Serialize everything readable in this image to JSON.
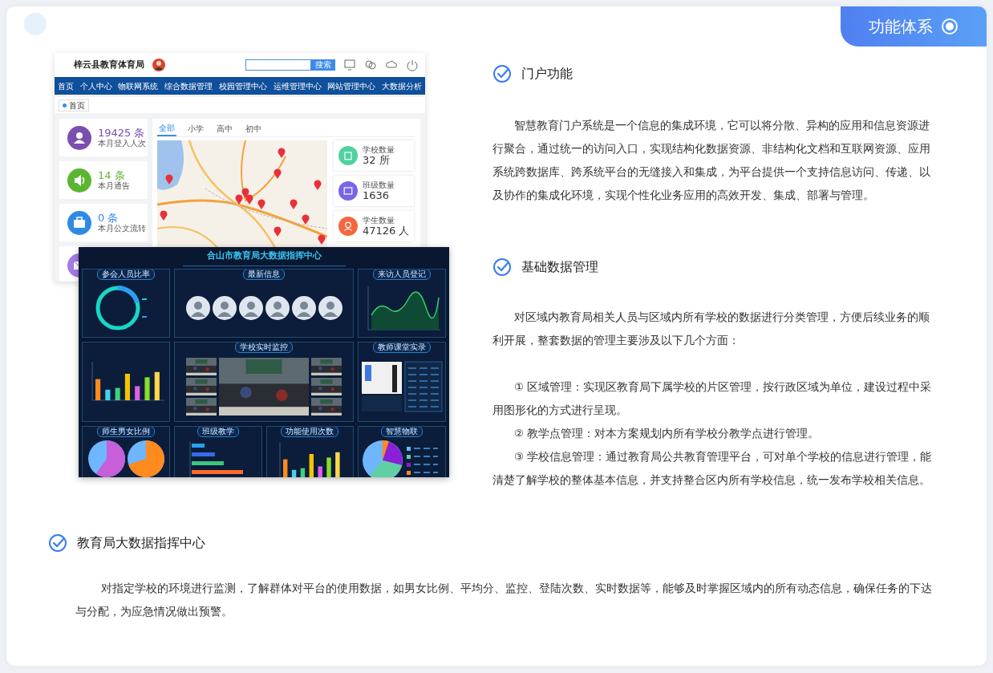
{
  "badge": {
    "label": "功能体系"
  },
  "portal": {
    "title": "梓云县教育体育局",
    "search_button": "搜索",
    "nav": [
      "首页",
      "个人中心",
      "物联网系统",
      "综合数据管理",
      "校园管理中心",
      "运维管理中心",
      "网站管理中心",
      "大数据分析"
    ],
    "breadcrumb": "首页",
    "stats": [
      {
        "value": "19425",
        "unit": "条",
        "label": "本月登入人次",
        "color": "#7b4fb0"
      },
      {
        "value": "14",
        "unit": "条",
        "label": "本月通告",
        "color": "#5cb531"
      },
      {
        "value": "0",
        "unit": "条",
        "label": "本月公文流转",
        "color": "#2f8ae5"
      },
      {
        "color": "#a47be8"
      }
    ],
    "tabs": [
      {
        "label": "全部",
        "selected": true
      },
      {
        "label": "小学",
        "selected": false
      },
      {
        "label": "高中",
        "selected": false
      },
      {
        "label": "初中",
        "selected": false
      }
    ],
    "counts": [
      {
        "label": "学校数量",
        "value": "32",
        "unit": "所",
        "color": "#4fd1a0"
      },
      {
        "label": "班级数量",
        "value": "1636",
        "color": "#7a63e8"
      },
      {
        "label": "学生数量",
        "value": "47126",
        "unit": "人",
        "color": "#f4663f"
      }
    ]
  },
  "dashboard": {
    "title": "合山市教育局大数据指挥中心",
    "panels": [
      {
        "title": "参会人员比率",
        "kind": "ring"
      },
      {
        "title": "最新信息",
        "kind": "people"
      },
      {
        "title": "来访人员登记",
        "kind": "line"
      },
      {
        "kind": "bars"
      },
      {
        "title": "学校实时监控",
        "kind": "video"
      },
      {
        "title": "教师课堂实录",
        "kind": "record"
      },
      {
        "title": "师生男女比例",
        "kind": "pies"
      },
      {
        "title": "班级教学",
        "kind": "hbars"
      },
      {
        "title": "功能使用次数",
        "kind": "bars"
      },
      {
        "title": "智慧物联",
        "kind": "pie"
      }
    ]
  },
  "sections": [
    {
      "heading": "门户功能",
      "paragraphs": [
        "智慧教育门户系统是一个信息的集成环境，它可以将分散、异构的应用和信息资源进行聚合，通过统一的访问入口，实现结构化数据资源、非结构化文档和互联网资源、应用系统跨数据库、跨系统平台的无缝接入和集成，为平台提供一个支持信息访问、传递、以及协作的集成化环境，实现个性化业务应用的高效开发、集成、部署与管理。"
      ]
    },
    {
      "heading": "基础数据管理",
      "paragraphs": [
        "对区域内教育局相关人员与区域内所有学校的数据进行分类管理，方便后续业务的顺利开展，整套数据的管理主要涉及以下几个方面：",
        "① 区域管理：实现区教育局下属学校的片区管理，按行政区域为单位，建设过程中采用图形化的方式进行呈现。",
        "② 教学点管理：对本方案规划内所有学校分教学点进行管理。",
        "③ 学校信息管理：通过教育局公共教育管理平台，可对单个学校的信息进行管理，能清楚了解学校的整体基本信息，并支持整合区内所有学校信息，统一发布学校相关信息。"
      ]
    },
    {
      "heading": "教育局大数据指挥中心",
      "paragraphs": [
        "对指定学校的环境进行监测，了解群体对平台的使用数据，如男女比例、平均分、监控、登陆次数、实时数据等，能够及时掌握区域内的所有动态信息，确保任务的下达与分配，为应急情况做出预警。"
      ]
    }
  ]
}
